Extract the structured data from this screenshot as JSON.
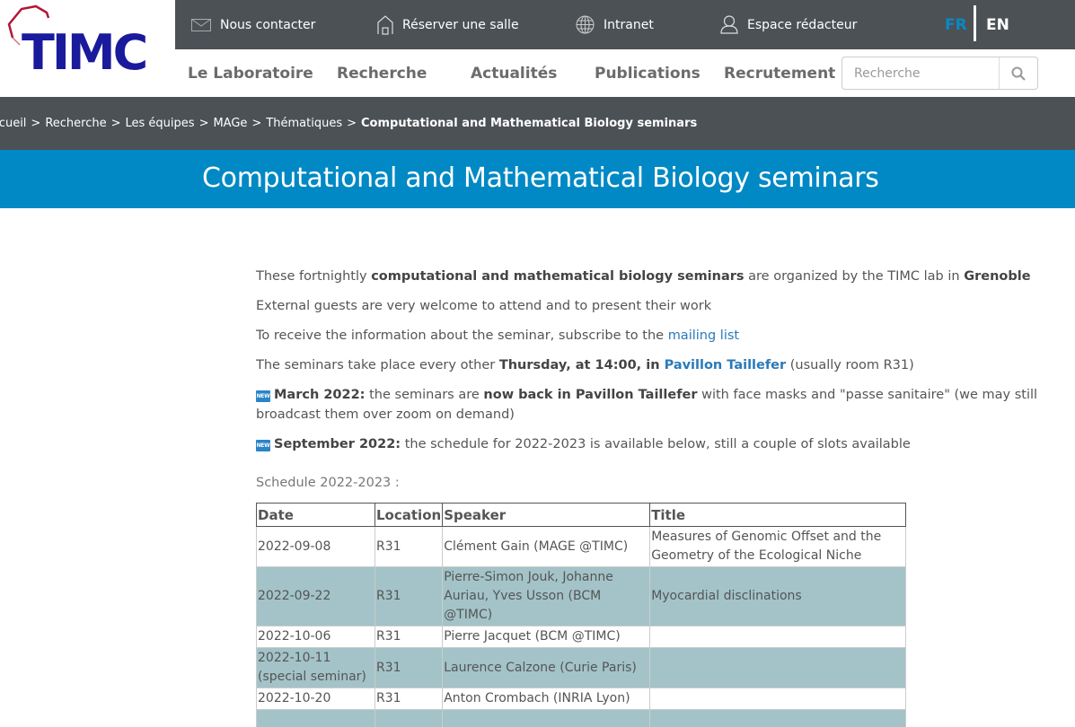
{
  "logo": {
    "text": "TIMC",
    "accent_color": "#b0183a",
    "brand_color": "#1a1a9c"
  },
  "topbar": {
    "links": [
      {
        "icon": "mail-icon",
        "label": "Nous contacter"
      },
      {
        "icon": "house-icon",
        "label": "Réserver une salle"
      },
      {
        "icon": "globe-icon",
        "label": "Intranet"
      },
      {
        "icon": "user-icon",
        "label": "Espace rédacteur"
      }
    ],
    "languages": [
      {
        "code": "FR",
        "active": true
      },
      {
        "code": "EN",
        "active": false
      }
    ]
  },
  "mainnav": {
    "items": [
      "Le Laboratoire",
      "Recherche",
      "Actualités",
      "Publications",
      "Recrutement"
    ],
    "search_placeholder": "Recherche"
  },
  "breadcrumb": {
    "items": [
      "Accueil",
      "Recherche",
      "Les équipes",
      "MAGe",
      "Thématiques"
    ],
    "current": "Computational and Mathematical Biology seminars"
  },
  "page_title": "Computational and Mathematical Biology seminars",
  "intro": {
    "p1": {
      "a": "These fortnightly ",
      "b": "computational and mathematical biology seminars",
      "c": " are organized by the TIMC lab in ",
      "d": "Grenoble"
    },
    "p2": "External guests are very welcome to attend and to present their work",
    "p3": {
      "a": "To receive the information about the seminar, subscribe to the ",
      "link": "mailing list"
    },
    "p4": {
      "a": "The seminars take place every other ",
      "b": "Thursday, at 14:00, in ",
      "link": "Pavillon Taillefer",
      "c": " (usually room R31)"
    },
    "news1": {
      "badge": "NEW",
      "b1": "March 2022:",
      "a": " the seminars are ",
      "b2": "now back in Pavillon Taillefer",
      "c": " with face masks and \"passe sanitaire\" (we may still broadcast them over zoom on demand)"
    },
    "news2": {
      "badge": "NEW",
      "b1": "September 2022:",
      "a": " the schedule for 2022-2023 is available below, still a couple of slots available"
    }
  },
  "schedule": {
    "label": "Schedule 2022-2023 :",
    "headers": [
      "Date",
      "Location",
      "Speaker",
      "Title"
    ],
    "rows": [
      {
        "date": "2022-09-08",
        "location": "R31",
        "speaker": "Clément Gain (MAGE @TIMC)",
        "title": "Measures of Genomic Offset and the Geometry of the Ecological Niche"
      },
      {
        "date": "2022-09-22",
        "location": "R31",
        "speaker": "Pierre-Simon Jouk, Johanne Auriau, Yves Usson (BCM @TIMC)",
        "title": "Myocardial disclinations"
      },
      {
        "date": "2022-10-06",
        "location": "R31",
        "speaker": "Pierre Jacquet (BCM @TIMC)",
        "title": ""
      },
      {
        "date": "2022-10-11 (special seminar)",
        "location": "R31",
        "speaker": "Laurence Calzone (Curie Paris)",
        "title": ""
      },
      {
        "date": "2022-10-20",
        "location": "R31",
        "speaker": "Anton Crombach (INRIA Lyon)",
        "title": ""
      },
      {
        "date": "",
        "location": "",
        "speaker": "",
        "title": ""
      }
    ],
    "alt_row_color": "#a3c3c8"
  }
}
